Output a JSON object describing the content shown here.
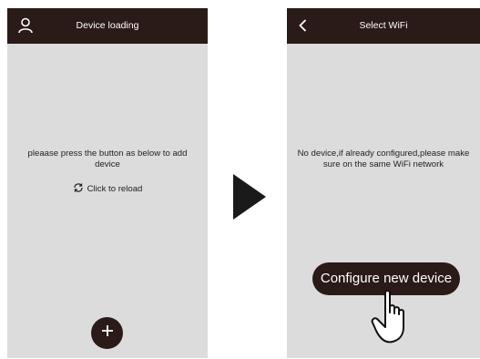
{
  "left_screen": {
    "header": {
      "title": "Device loading",
      "icon": "user-icon"
    },
    "message": "pleaase press the button as below to add device",
    "reload": {
      "icon": "reload-icon",
      "label": "Click to reload"
    },
    "add_button": {
      "icon": "plus-icon"
    }
  },
  "transition": {
    "icon": "play-arrow-icon"
  },
  "right_screen": {
    "header": {
      "title": "Select WiFi",
      "icon": "back-chevron-icon"
    },
    "message": "No device,if already configured,please make sure on the same WiFi network",
    "configure_button": {
      "label": "Configure new device"
    },
    "pointer": {
      "icon": "hand-pointer-icon"
    }
  },
  "colors": {
    "bar": "#2a1a18",
    "screen_bg": "#dcdcdc",
    "text": "#222222"
  }
}
